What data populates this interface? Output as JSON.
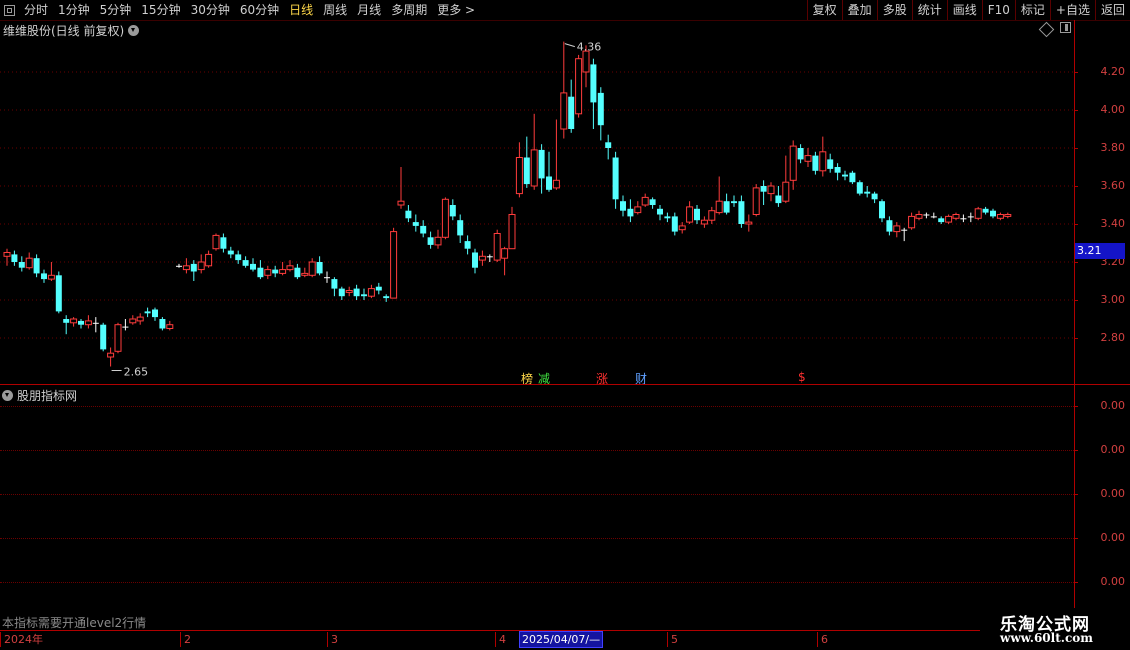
{
  "toolbar": {
    "periods": [
      "分时",
      "1分钟",
      "5分钟",
      "15分钟",
      "30分钟",
      "60分钟",
      "日线",
      "周线",
      "月线",
      "多周期",
      "更多 >"
    ],
    "active_period": "日线",
    "buttons": [
      "复权",
      "叠加",
      "多股",
      "统计",
      "画线",
      "F10",
      "标记",
      "+自选",
      "返回"
    ]
  },
  "main_panel": {
    "title": "维维股份(日线 前复权)",
    "y_ticks": [
      "4.20",
      "4.00",
      "3.80",
      "3.60",
      "3.40",
      "3.20",
      "3.00",
      "2.80"
    ],
    "last_price": "3.21",
    "high_marker": "4.36",
    "low_marker": "2.65",
    "event_tags": [
      {
        "text": "榜",
        "color": "#ffd84a"
      },
      {
        "text": "减",
        "color": "#40e040"
      },
      {
        "text": "涨",
        "color": "#ff3030"
      },
      {
        "text": "财",
        "color": "#60a0ff"
      },
      {
        "text": "$",
        "color": "#ff3030"
      }
    ]
  },
  "indicator_panel": {
    "title": "股朋指标网",
    "y_ticks": [
      "0.00",
      "0.00",
      "0.00",
      "0.00",
      "0.00"
    ],
    "notice": "本指标需要开通level2行情"
  },
  "date_axis": {
    "months": [
      "2024年",
      "2",
      "3",
      "4",
      "5",
      "6"
    ],
    "cursor_date": "2025/04/07/—"
  },
  "logo": {
    "line1": "乐淘公式网",
    "line2": "www.60lt.com"
  },
  "colors": {
    "up": "#ff3c3c",
    "down": "#54ffff",
    "axis": "#b00000",
    "grid": "#8a0000"
  },
  "chart_data": {
    "type": "candlestick",
    "title": "维维股份(日线 前复权)",
    "ylim": [
      2.6,
      4.45
    ],
    "candles": [
      [
        3.23,
        3.25,
        3.27,
        3.18
      ],
      [
        3.24,
        3.2,
        3.26,
        3.18
      ],
      [
        3.2,
        3.17,
        3.23,
        3.15
      ],
      [
        3.17,
        3.22,
        3.25,
        3.16
      ],
      [
        3.22,
        3.14,
        3.24,
        3.12
      ],
      [
        3.14,
        3.11,
        3.16,
        3.09
      ],
      [
        3.11,
        3.13,
        3.2,
        3.1
      ],
      [
        3.13,
        2.94,
        3.15,
        2.93
      ],
      [
        2.9,
        2.88,
        2.92,
        2.82
      ],
      [
        2.88,
        2.9,
        2.91,
        2.86
      ],
      [
        2.89,
        2.87,
        2.9,
        2.85
      ],
      [
        2.87,
        2.89,
        2.92,
        2.85
      ],
      [
        2.88,
        2.88,
        2.91,
        2.83
      ],
      [
        2.87,
        2.74,
        2.88,
        2.73
      ],
      [
        2.7,
        2.72,
        2.75,
        2.65
      ],
      [
        2.73,
        2.87,
        2.88,
        2.72
      ],
      [
        2.86,
        2.86,
        2.9,
        2.84
      ],
      [
        2.88,
        2.9,
        2.92,
        2.87
      ],
      [
        2.89,
        2.91,
        2.93,
        2.87
      ],
      [
        2.94,
        2.93,
        2.96,
        2.91
      ],
      [
        2.95,
        2.91,
        2.96,
        2.89
      ],
      [
        2.9,
        2.85,
        2.91,
        2.84
      ],
      [
        2.85,
        2.87,
        2.89,
        2.84
      ],
      [
        3.18,
        3.18,
        3.19,
        3.17
      ],
      [
        3.16,
        3.18,
        3.22,
        3.14
      ],
      [
        3.19,
        3.15,
        3.21,
        3.1
      ],
      [
        3.16,
        3.2,
        3.24,
        3.14
      ],
      [
        3.18,
        3.24,
        3.26,
        3.17
      ],
      [
        3.27,
        3.34,
        3.35,
        3.26
      ],
      [
        3.33,
        3.27,
        3.35,
        3.25
      ],
      [
        3.26,
        3.24,
        3.28,
        3.22
      ],
      [
        3.24,
        3.21,
        3.26,
        3.19
      ],
      [
        3.21,
        3.18,
        3.23,
        3.17
      ],
      [
        3.19,
        3.16,
        3.22,
        3.15
      ],
      [
        3.17,
        3.12,
        3.21,
        3.11
      ],
      [
        3.13,
        3.16,
        3.18,
        3.11
      ],
      [
        3.16,
        3.14,
        3.18,
        3.12
      ],
      [
        3.14,
        3.16,
        3.2,
        3.13
      ],
      [
        3.16,
        3.18,
        3.21,
        3.15
      ],
      [
        3.17,
        3.12,
        3.19,
        3.11
      ],
      [
        3.13,
        3.14,
        3.17,
        3.12
      ],
      [
        3.13,
        3.2,
        3.22,
        3.12
      ],
      [
        3.2,
        3.14,
        3.23,
        3.13
      ],
      [
        3.12,
        3.12,
        3.15,
        3.09
      ],
      [
        3.11,
        3.06,
        3.12,
        3.02
      ],
      [
        3.06,
        3.02,
        3.07,
        3.0
      ],
      [
        3.04,
        3.05,
        3.07,
        3.02
      ],
      [
        3.06,
        3.02,
        3.08,
        3.0
      ],
      [
        3.03,
        3.02,
        3.06,
        3.0
      ],
      [
        3.02,
        3.06,
        3.08,
        3.01
      ],
      [
        3.07,
        3.05,
        3.09,
        3.03
      ],
      [
        3.02,
        3.01,
        3.03,
        2.99
      ],
      [
        3.01,
        3.36,
        3.38,
        3.01
      ],
      [
        3.5,
        3.52,
        3.7,
        3.48
      ],
      [
        3.47,
        3.43,
        3.5,
        3.41
      ],
      [
        3.41,
        3.39,
        3.45,
        3.36
      ],
      [
        3.39,
        3.35,
        3.42,
        3.33
      ],
      [
        3.33,
        3.29,
        3.36,
        3.27
      ],
      [
        3.29,
        3.33,
        3.37,
        3.27
      ],
      [
        3.33,
        3.53,
        3.54,
        3.32
      ],
      [
        3.5,
        3.44,
        3.53,
        3.42
      ],
      [
        3.42,
        3.34,
        3.45,
        3.3
      ],
      [
        3.31,
        3.27,
        3.34,
        3.24
      ],
      [
        3.25,
        3.17,
        3.27,
        3.14
      ],
      [
        3.21,
        3.23,
        3.26,
        3.18
      ],
      [
        3.23,
        3.23,
        3.24,
        3.2
      ],
      [
        3.21,
        3.35,
        3.37,
        3.2
      ],
      [
        3.22,
        3.27,
        3.28,
        3.13
      ],
      [
        3.27,
        3.45,
        3.49,
        3.27
      ],
      [
        3.56,
        3.75,
        3.83,
        3.54
      ],
      [
        3.75,
        3.61,
        3.86,
        3.59
      ],
      [
        3.6,
        3.79,
        3.98,
        3.58
      ],
      [
        3.79,
        3.64,
        3.82,
        3.56
      ],
      [
        3.65,
        3.58,
        3.78,
        3.57
      ],
      [
        3.59,
        3.63,
        3.95,
        3.58
      ],
      [
        3.9,
        4.09,
        4.36,
        3.85
      ],
      [
        4.07,
        3.9,
        4.16,
        3.88
      ],
      [
        3.98,
        4.27,
        4.29,
        3.96
      ],
      [
        4.2,
        4.31,
        4.34,
        4.12
      ],
      [
        4.24,
        4.04,
        4.27,
        3.9
      ],
      [
        4.09,
        3.92,
        4.12,
        3.84
      ],
      [
        3.83,
        3.8,
        3.87,
        3.74
      ],
      [
        3.75,
        3.53,
        3.78,
        3.48
      ],
      [
        3.52,
        3.47,
        3.55,
        3.44
      ],
      [
        3.48,
        3.44,
        3.53,
        3.41
      ],
      [
        3.46,
        3.49,
        3.52,
        3.45
      ],
      [
        3.5,
        3.54,
        3.56,
        3.49
      ],
      [
        3.53,
        3.5,
        3.54,
        3.48
      ],
      [
        3.48,
        3.45,
        3.5,
        3.42
      ],
      [
        3.44,
        3.43,
        3.46,
        3.41
      ],
      [
        3.44,
        3.36,
        3.46,
        3.34
      ],
      [
        3.37,
        3.39,
        3.41,
        3.35
      ],
      [
        3.41,
        3.49,
        3.52,
        3.4
      ],
      [
        3.48,
        3.42,
        3.5,
        3.4
      ],
      [
        3.4,
        3.42,
        3.44,
        3.38
      ],
      [
        3.42,
        3.47,
        3.49,
        3.4
      ],
      [
        3.46,
        3.52,
        3.65,
        3.45
      ],
      [
        3.52,
        3.46,
        3.56,
        3.45
      ],
      [
        3.52,
        3.51,
        3.55,
        3.49
      ],
      [
        3.52,
        3.4,
        3.55,
        3.38
      ],
      [
        3.4,
        3.41,
        3.45,
        3.36
      ],
      [
        3.45,
        3.59,
        3.61,
        3.44
      ],
      [
        3.6,
        3.57,
        3.63,
        3.5
      ],
      [
        3.56,
        3.6,
        3.62,
        3.52
      ],
      [
        3.55,
        3.51,
        3.6,
        3.49
      ],
      [
        3.52,
        3.62,
        3.76,
        3.51
      ],
      [
        3.63,
        3.81,
        3.84,
        3.58
      ],
      [
        3.8,
        3.74,
        3.82,
        3.72
      ],
      [
        3.73,
        3.76,
        3.8,
        3.7
      ],
      [
        3.76,
        3.68,
        3.78,
        3.66
      ],
      [
        3.68,
        3.78,
        3.86,
        3.65
      ],
      [
        3.74,
        3.69,
        3.77,
        3.67
      ],
      [
        3.7,
        3.67,
        3.72,
        3.63
      ],
      [
        3.66,
        3.65,
        3.68,
        3.63
      ],
      [
        3.67,
        3.62,
        3.68,
        3.61
      ],
      [
        3.62,
        3.56,
        3.63,
        3.55
      ],
      [
        3.57,
        3.56,
        3.6,
        3.54
      ],
      [
        3.56,
        3.53,
        3.57,
        3.51
      ],
      [
        3.52,
        3.43,
        3.53,
        3.41
      ],
      [
        3.42,
        3.36,
        3.44,
        3.34
      ],
      [
        3.36,
        3.39,
        3.41,
        3.33
      ],
      [
        3.37,
        3.37,
        3.38,
        3.31
      ],
      [
        3.38,
        3.44,
        3.46,
        3.37
      ],
      [
        3.43,
        3.45,
        3.47,
        3.42
      ],
      [
        3.45,
        3.45,
        3.46,
        3.43
      ],
      [
        3.44,
        3.44,
        3.46,
        3.43
      ],
      [
        3.43,
        3.41,
        3.44,
        3.4
      ],
      [
        3.41,
        3.44,
        3.45,
        3.4
      ],
      [
        3.43,
        3.45,
        3.46,
        3.42
      ],
      [
        3.43,
        3.43,
        3.45,
        3.41
      ],
      [
        3.44,
        3.44,
        3.46,
        3.41
      ],
      [
        3.43,
        3.48,
        3.49,
        3.42
      ],
      [
        3.48,
        3.46,
        3.49,
        3.45
      ],
      [
        3.47,
        3.44,
        3.48,
        3.43
      ],
      [
        3.43,
        3.45,
        3.46,
        3.42
      ],
      [
        3.44,
        3.45,
        3.46,
        3.43
      ]
    ]
  }
}
